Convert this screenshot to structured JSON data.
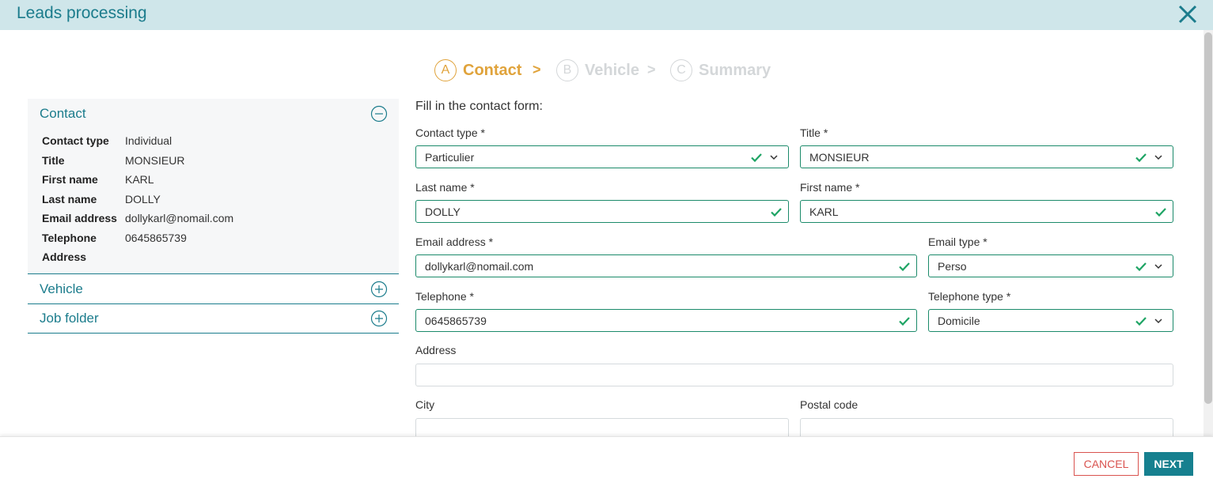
{
  "window": {
    "title": "Leads processing"
  },
  "stepper": {
    "steps": [
      {
        "letter": "A",
        "label": "Contact"
      },
      {
        "letter": "B",
        "label": "Vehicle"
      },
      {
        "letter": "C",
        "label": "Summary"
      }
    ],
    "separator": ">"
  },
  "sidebar": {
    "contact": {
      "title": "Contact",
      "rows": [
        {
          "key": "Contact type",
          "value": "Individual"
        },
        {
          "key": "Title",
          "value": "MONSIEUR"
        },
        {
          "key": "First name",
          "value": "KARL"
        },
        {
          "key": "Last name",
          "value": "DOLLY"
        },
        {
          "key": "Email address",
          "value": "dollykarl@nomail.com"
        },
        {
          "key": "Telephone",
          "value": "0645865739"
        },
        {
          "key": "Address",
          "value": ""
        }
      ]
    },
    "vehicle": {
      "title": "Vehicle"
    },
    "job_folder": {
      "title": "Job folder"
    }
  },
  "form": {
    "intro": "Fill in the contact form:",
    "contact_type": {
      "label": "Contact type *",
      "value": "Particulier"
    },
    "title": {
      "label": "Title *",
      "value": "MONSIEUR"
    },
    "last_name": {
      "label": "Last name *",
      "value": "DOLLY"
    },
    "first_name": {
      "label": "First name *",
      "value": "KARL"
    },
    "email": {
      "label": "Email address *",
      "value": "dollykarl@nomail.com"
    },
    "email_type": {
      "label": "Email type *",
      "value": "Perso"
    },
    "telephone": {
      "label": "Telephone *",
      "value": "0645865739"
    },
    "telephone_type": {
      "label": "Telephone type *",
      "value": "Domicile"
    },
    "address": {
      "label": "Address",
      "value": ""
    },
    "city": {
      "label": "City",
      "value": ""
    },
    "postal_code": {
      "label": "Postal code",
      "value": ""
    }
  },
  "footer": {
    "cancel_label": "CANCEL",
    "next_label": "NEXT"
  },
  "colors": {
    "accent": "#1b7c8c",
    "active_step": "#e0a33b",
    "valid": "#1ea464",
    "cancel": "#d9534f",
    "titlebar": "#cfe6ea"
  }
}
